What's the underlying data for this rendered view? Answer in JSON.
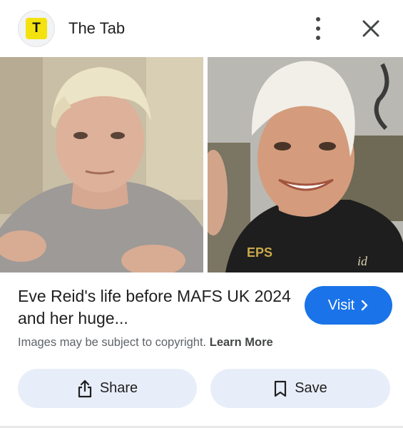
{
  "header": {
    "logo_letter": "T",
    "site_name": "The Tab",
    "icons": {
      "more": "more-vertical-icon",
      "close": "close-icon"
    }
  },
  "images": {
    "lens_icon": "google-lens-icon",
    "right_image_shirt_text": "EPS",
    "right_image_badge_text": "id"
  },
  "result": {
    "title": "Eve Reid's life before MAFS UK 2024 and her huge...",
    "visit_label": "Visit",
    "copyright_text": "Images may be subject to copyright.",
    "learn_more_label": "Learn More"
  },
  "actions": {
    "share_label": "Share",
    "share_icon": "share-icon",
    "save_label": "Save",
    "save_icon": "bookmark-icon"
  },
  "colors": {
    "accent": "#1a73e8",
    "button_bg": "#e8eef9",
    "logo_yellow": "#f4e20f",
    "muted_text": "#5f6368"
  }
}
